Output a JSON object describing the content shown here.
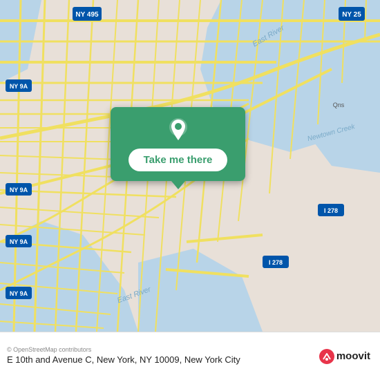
{
  "map": {
    "alt": "Map of Manhattan, New York City area",
    "attribution": "© OpenStreetMap contributors",
    "attribution_link": "#"
  },
  "popup": {
    "button_label": "Take me there",
    "pin_icon": "location-pin-icon"
  },
  "bottom_bar": {
    "location_text": "E 10th and Avenue C, New York, NY 10009, New York City",
    "attribution_text": "© OpenStreetMap contributors",
    "moovit_label": "moovit"
  }
}
